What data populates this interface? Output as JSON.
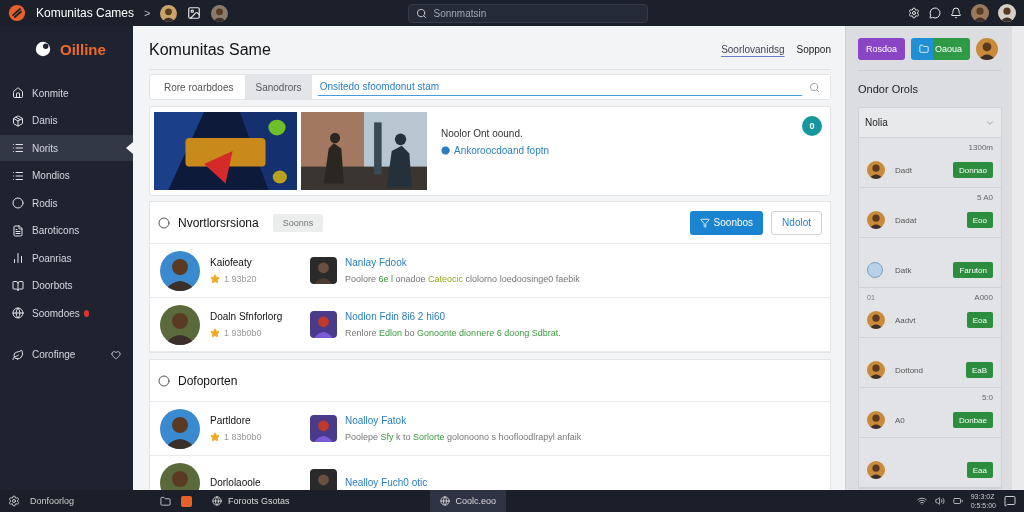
{
  "topbar": {
    "app_title": "Komunitas Cames",
    "crumb": ">",
    "search": {
      "placeholder": "Sonnmatsin"
    }
  },
  "sidebar": {
    "brand": "Oilline",
    "items": [
      {
        "label": "Konmite",
        "selected": false,
        "alert": false,
        "favorite": false
      },
      {
        "label": "Danis",
        "selected": false,
        "alert": false,
        "favorite": false
      },
      {
        "label": "Norits",
        "selected": true,
        "alert": false,
        "favorite": false
      },
      {
        "label": "Mondios",
        "selected": false,
        "alert": false,
        "favorite": false
      },
      {
        "label": "Rodis",
        "selected": false,
        "alert": false,
        "favorite": false
      },
      {
        "label": "Baroticons",
        "selected": false,
        "alert": false,
        "favorite": false
      },
      {
        "label": "Poanrias",
        "selected": false,
        "alert": false,
        "favorite": false
      },
      {
        "label": "Doorbots",
        "selected": false,
        "alert": false,
        "favorite": false
      },
      {
        "label": "Soomdoes",
        "selected": false,
        "alert": true,
        "favorite": false
      },
      {
        "label": "Corofinge",
        "selected": false,
        "alert": false,
        "favorite": true
      }
    ]
  },
  "page": {
    "title": "Komunitas Same",
    "links": [
      {
        "label": "Soorlovanidsg",
        "selected": true
      },
      {
        "label": "Soppon",
        "selected": false
      }
    ],
    "tabs": [
      {
        "label": "Rore roarbdoes",
        "selected": false
      },
      {
        "label": "Sanodrors",
        "selected": true
      }
    ],
    "filter": {
      "value": "Onsitedo sfoomdonut stam"
    },
    "banner": {
      "heading": "Noolor Ont oound.",
      "link": "Ankoroocdoand foptn",
      "badge": "0"
    },
    "sections": [
      {
        "title": "Nvortlorsrsiona",
        "chip": "Soonns",
        "actions": [
          {
            "label": "Soonbos",
            "kind": "primary"
          },
          {
            "label": "Ndolot",
            "kind": "outline"
          }
        ],
        "rows": [
          {
            "name": "Kaiofeaty",
            "rating": "1 93b20",
            "title": "Nanlay Fdook",
            "desc": [
              {
                "text": "Poolore ",
                "kind": "plain"
              },
              {
                "text": "6e l",
                "kind": "green"
              },
              {
                "text": " onadoe ",
                "kind": "plain"
              },
              {
                "text": "Cateocic",
                "kind": "lime"
              },
              {
                "text": " clolorno loedoosinge0 faebik",
                "kind": "plain"
              }
            ]
          },
          {
            "name": "Doaln Sfnforlorg",
            "rating": "1 93b0b0",
            "title": "Nodlon Fdin 8i6 2 hi60",
            "desc": [
              {
                "text": "Renlore ",
                "kind": "plain"
              },
              {
                "text": "Edlon",
                "kind": "green"
              },
              {
                "text": " bo ",
                "kind": "plain"
              },
              {
                "text": "Gonoonte dionnere 6 doong Sdbrat.",
                "kind": "green"
              }
            ]
          }
        ]
      },
      {
        "title": "Dofoporten",
        "rows": [
          {
            "name": "Partldore",
            "rating": "1 83b0b0",
            "title": "Noalloy Fatok",
            "desc": [
              {
                "text": "Poolepe ",
                "kind": "plain"
              },
              {
                "text": "Sfy",
                "kind": "green"
              },
              {
                "text": " k to ",
                "kind": "plain"
              },
              {
                "text": "Sorlorte",
                "kind": "green"
              },
              {
                "text": " golonoono s hoofloodlrapyl anfaik",
                "kind": "plain"
              }
            ]
          },
          {
            "name": "Dorlolaoole",
            "title": "Nealloy Fuch0 otic"
          }
        ]
      }
    ]
  },
  "panel": {
    "actions": [
      {
        "label": "Rosdoa",
        "kind": "purple"
      },
      {
        "label": "Oaoua",
        "kind": "split"
      }
    ],
    "heading": "Ondor Orols",
    "dropdown": "Nolia",
    "entries": [
      {
        "time": "1300m",
        "name": "Dadt",
        "action": "Donnao",
        "kind": "person"
      },
      {
        "time": "5 A0",
        "name": "Dadat",
        "action": "Eoo",
        "kind": "person"
      },
      {
        "name": "Datk",
        "action": "Faruton",
        "kind": "group"
      },
      {
        "tag": "01",
        "time": "A000",
        "name": "Aadvt",
        "action": "Eoa",
        "kind": "person"
      },
      {
        "name": "Dottond",
        "action": "EaB",
        "kind": "person"
      },
      {
        "time": "5:0",
        "name": "A0",
        "action": "Donbae",
        "kind": "person"
      },
      {
        "action": "Eaa",
        "kind": "person"
      }
    ]
  },
  "taskbar": {
    "start_label": "Donfoorlog",
    "tasks": [
      {
        "label": "Foroots Gsotas",
        "selected": false
      },
      {
        "label": "Coolc.eoo",
        "selected": true
      }
    ],
    "clock": [
      "93:3:0Z",
      "0:5:5:00"
    ]
  }
}
